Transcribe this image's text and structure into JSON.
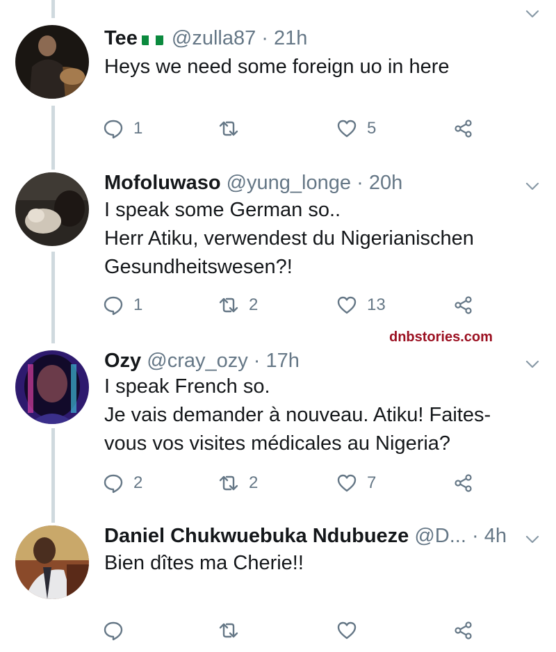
{
  "watermark": "dnbstories.com",
  "colors": {
    "text": "#14171a",
    "secondary": "#657786",
    "thread_line": "#cfd9de",
    "watermark": "#9b1021"
  },
  "tweets": [
    {
      "name": "Tee",
      "flag": "nigeria-flag",
      "handle": "@zulla87",
      "dot": "·",
      "time": "21h",
      "lines": [
        "Heys we need some foreign uo in here"
      ],
      "reply_count": "1",
      "retweet_count": "",
      "like_count": "5"
    },
    {
      "name": "Mofoluwaso",
      "handle": "@yung_longe",
      "dot": "·",
      "time": "20h",
      "lines": [
        "I speak some German so..",
        "Herr Atiku, verwendest du Nigerianischen",
        "Gesundheitswesen?!"
      ],
      "reply_count": "1",
      "retweet_count": "2",
      "like_count": "13"
    },
    {
      "name": "Ozy",
      "handle": "@cray_ozy",
      "dot": "·",
      "time": "17h",
      "lines": [
        "I speak French so.",
        "Je vais demander à nouveau. Atiku! Faites-",
        "vous vos visites médicales au Nigeria?"
      ],
      "reply_count": "2",
      "retweet_count": "2",
      "like_count": "7"
    },
    {
      "name": "Daniel Chukwuebuka Ndubueze",
      "handle": "@D...",
      "dot": "·",
      "time": "4h",
      "lines": [
        "Bien dîtes ma Cherie!!"
      ],
      "reply_count": "",
      "retweet_count": "",
      "like_count": ""
    }
  ]
}
